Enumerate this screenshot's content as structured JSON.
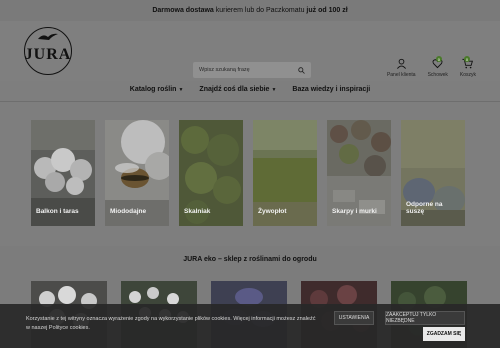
{
  "topbar": {
    "text_bold": "Darmowa dostawa",
    "text_mid": " kurierem lub do Paczkomatu ",
    "text_bold2": "już od 100 zł"
  },
  "logo": {
    "text": "JURA"
  },
  "search": {
    "placeholder": "Wpisz szukaną frazę"
  },
  "header_icons": {
    "account": "Panel klienta",
    "wishlist": "Schowek",
    "wishlist_count": "0",
    "cart": "Koszyk",
    "cart_count": "0"
  },
  "nav": [
    {
      "label": "Katalog roślin"
    },
    {
      "label": "Znajdź coś dla siebie"
    },
    {
      "label": "Baza wiedzy i inspiracji"
    }
  ],
  "categories": [
    {
      "label": "Balkon i taras"
    },
    {
      "label": "Miododajne"
    },
    {
      "label": "Skalniak"
    },
    {
      "label": "Żywopłot"
    },
    {
      "label": "Skarpy i murki"
    },
    {
      "label": "Odporne na suszę"
    }
  ],
  "section": {
    "title": "JURA eko – sklep z roślinami do ogrodu"
  },
  "cookie": {
    "text": "Korzystanie z tej witryny oznacza wyrażenie zgody na wykorzystanie plików cookies. Więcej informacji możesz znaleźć w naszej Polityce cookies.",
    "settings_label": "USTAWIENIA",
    "necessary_label": "ZAAKCEPTUJ TYLKO NIEZBĘDNE",
    "accept_label": "ZGADZAM SIĘ"
  },
  "colors": {
    "overlay_grey": "#7e7e7e",
    "badge": "#4a7a2a",
    "cookie_bg": "#282828"
  }
}
